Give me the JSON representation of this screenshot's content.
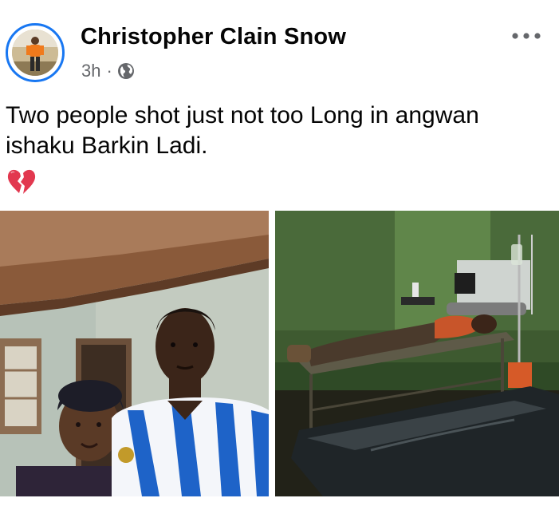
{
  "post": {
    "author": "Christopher Clain Snow",
    "time": "3h",
    "separator": "·",
    "audience_icon": "globe-icon",
    "more_icon": "more-options-icon",
    "text_lines": [
      "Two people shot just not too Long in angwan",
      "ishaku Barkin Ladi."
    ],
    "emoji": "broken-heart-icon",
    "photos": [
      {
        "icon": "photo-couple-selfie"
      },
      {
        "icon": "photo-hospital-stretcher"
      }
    ]
  },
  "colors": {
    "accent": "#1877f2",
    "text": "#050505",
    "secondary_text": "#65676b",
    "emoji_red": "#e2384f"
  }
}
